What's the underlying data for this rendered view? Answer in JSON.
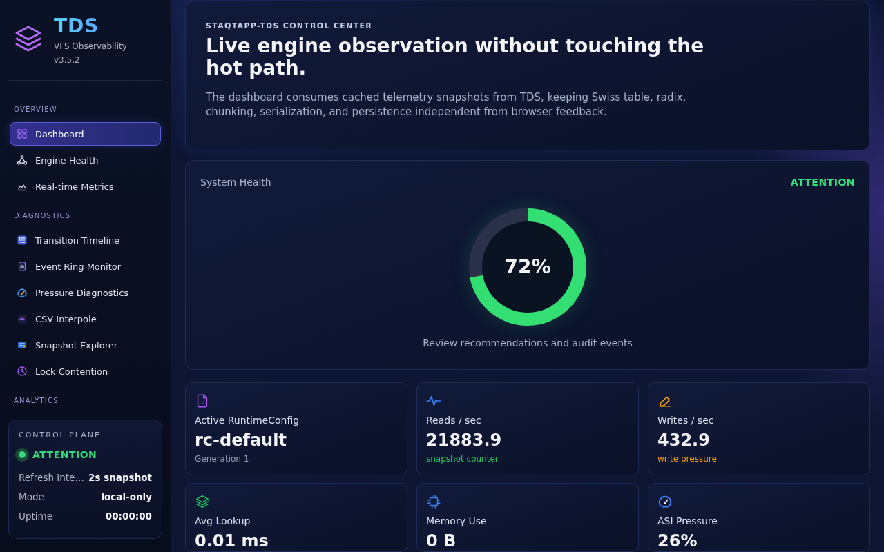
{
  "sidebar": {
    "brand": {
      "name": "TDS",
      "subtitle": "VFS Observability",
      "version": "v3.5.2"
    },
    "sections": [
      {
        "title": "OVERVIEW",
        "items": [
          {
            "label": "Dashboard",
            "selected": true
          },
          {
            "label": "Engine Health",
            "selected": false
          },
          {
            "label": "Real-time Metrics",
            "selected": false
          }
        ]
      },
      {
        "title": "DIAGNOSTICS",
        "items": [
          {
            "label": "Transition Timeline",
            "selected": false
          },
          {
            "label": "Event Ring Monitor",
            "selected": false
          },
          {
            "label": "Pressure Diagnostics",
            "selected": false
          },
          {
            "label": "CSV Interpole",
            "selected": false
          },
          {
            "label": "Snapshot Explorer",
            "selected": false
          },
          {
            "label": "Lock Contention",
            "selected": false
          }
        ]
      },
      {
        "title": "ANALYTICS"
      }
    ],
    "control_plane": {
      "title": "CONTROL PLANE",
      "status": "ATTENTION",
      "rows": [
        {
          "label": "Refresh Inte…",
          "value": "2s snapshot"
        },
        {
          "label": "Mode",
          "value": "local-only"
        },
        {
          "label": "Uptime",
          "value": "00:00:00"
        }
      ]
    }
  },
  "header": {
    "eyebrow": "STAQTAPP-TDS CONTROL CENTER",
    "title": "Live engine observation without touching the hot path.",
    "description": "The dashboard consumes cached telemetry snapshots from TDS, keeping Swiss table, radix, chunking, serialization, and persistence independent from browser feedback."
  },
  "health": {
    "title": "System Health",
    "status": "ATTENTION",
    "level": 0.72,
    "reading": "72%",
    "caption": "Review recommendations and audit events"
  },
  "metrics": [
    {
      "label": "Active RuntimeConfig",
      "value": "rc-default",
      "note": {
        "text": "Generation 1",
        "color": "#94a3b8"
      }
    },
    {
      "label": "Reads / sec",
      "value": "21883.9",
      "note": {
        "text": "snapshot counter",
        "color": "#22c55e"
      }
    },
    {
      "label": "Writes / sec",
      "value": "432.9",
      "note": {
        "text": "write pressure",
        "color": "#f59e0b"
      }
    },
    {
      "label": "Avg Lookup",
      "value": "0.01 ms"
    },
    {
      "label": "Memory Use",
      "value": "0 B"
    },
    {
      "label": "ASI Pressure",
      "value": "26%"
    }
  ]
}
